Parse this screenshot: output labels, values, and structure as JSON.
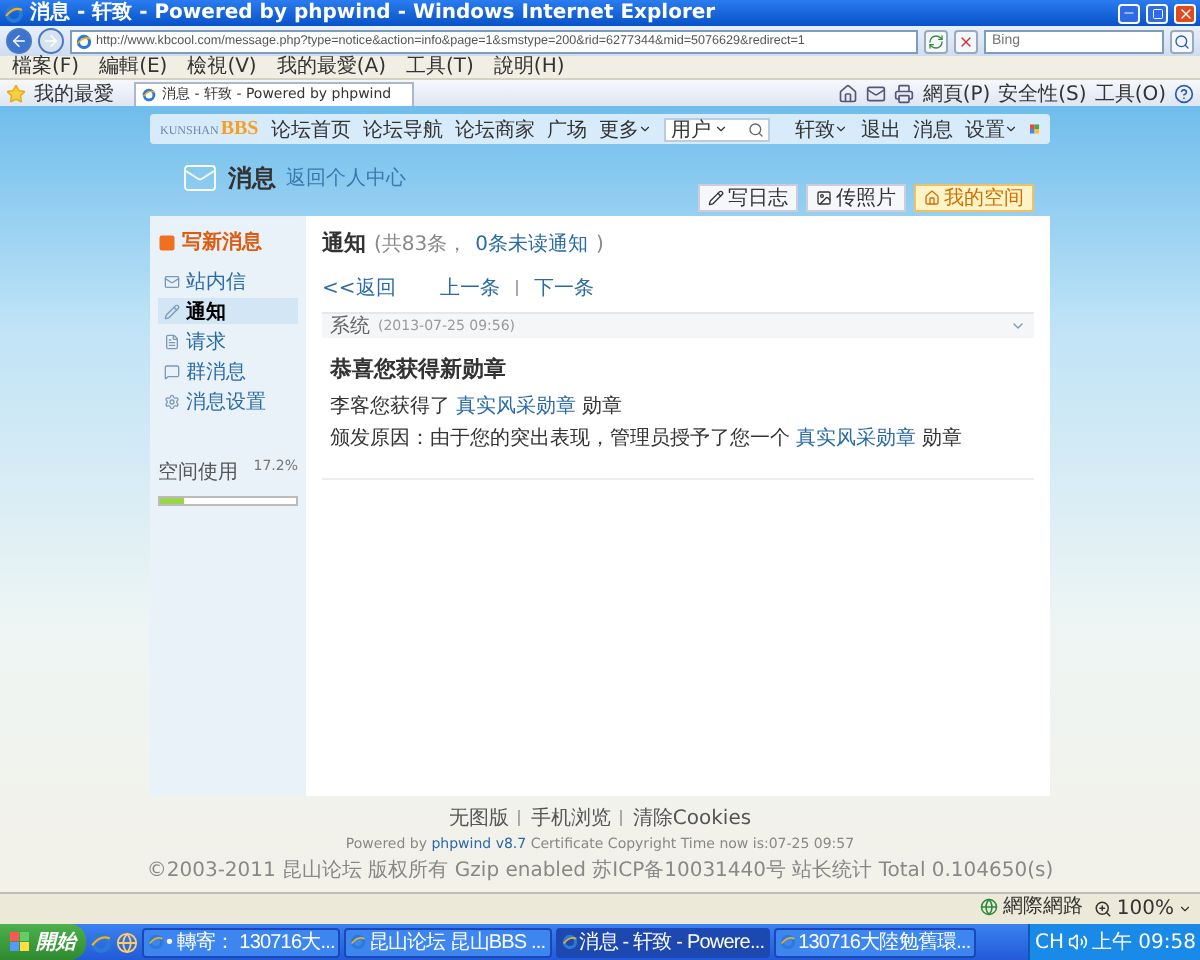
{
  "window": {
    "title": "消息 - 轩致 - Powered by phpwind - Windows Internet Explorer"
  },
  "address_bar": {
    "url": "http://www.kbcool.com/message.php?type=notice&action=info&page=1&smstype=200&rid=6277344&mid=5076629&redirect=1"
  },
  "search_box": {
    "placeholder": "Bing"
  },
  "menu_bar": [
    "檔案(F)",
    "編輯(E)",
    "檢視(V)",
    "我的最愛(A)",
    "工具(T)",
    "說明(H)"
  ],
  "favorites_bar": {
    "label": "我的最愛",
    "tabs": [
      {
        "label": "消息 - 轩致 - Powered by phpwind",
        "selected": true
      }
    ]
  },
  "command_bar": [
    "網頁(P)",
    "安全性(S)",
    "工具(O)"
  ],
  "site_nav": {
    "logo_small": "KUNSHAN",
    "logo_big": "BBS",
    "links": [
      {
        "label": "论坛首页",
        "dropdown": false
      },
      {
        "label": "论坛导航",
        "dropdown": false
      },
      {
        "label": "论坛商家",
        "dropdown": false
      },
      {
        "label": "广场",
        "dropdown": false
      },
      {
        "label": "更多",
        "dropdown": true
      }
    ],
    "search_scope": "用户",
    "user_links": [
      {
        "label": "轩致",
        "dropdown": true
      },
      {
        "label": "退出",
        "dropdown": false
      },
      {
        "label": "消息",
        "dropdown": false
      },
      {
        "label": "设置",
        "dropdown": true
      }
    ]
  },
  "banner": {
    "title": "消息",
    "subtitle": "返回个人中心",
    "buttons": [
      {
        "label": "写日志",
        "selected": false
      },
      {
        "label": "传照片",
        "selected": false
      },
      {
        "label": "我的空间",
        "selected": true
      }
    ]
  },
  "sidebar": {
    "compose": "写新消息",
    "items": [
      {
        "label": "站内信",
        "selected": false
      },
      {
        "label": "通知",
        "selected": true
      },
      {
        "label": "请求",
        "selected": false
      },
      {
        "label": "群消息",
        "selected": false
      },
      {
        "label": "消息设置",
        "selected": false
      }
    ],
    "storage": {
      "label": "空间使用",
      "reading": "17.2%",
      "level": 0.172
    }
  },
  "main": {
    "title": "通知",
    "count": "(共83条，",
    "unread": "0条未读通知",
    "count_end": ")",
    "back": "<<返回",
    "prev": "上一条",
    "next": "下一条",
    "message": {
      "sender": "系统",
      "time": "(2013-07-25 09:56)",
      "subject": "恭喜您获得新勋章",
      "lines": [
        {
          "before": "李客您获得了",
          "link": "真实风采勋章",
          "after": "勋章"
        },
        {
          "before": "颁发原因：由于您的突出表现，管理员授予了您一个",
          "link": "真实风采勋章",
          "after": "勋章"
        }
      ]
    }
  },
  "footer": {
    "links": [
      "无图版",
      "手机浏览",
      "清除Cookies"
    ],
    "powered_before": "Powered by",
    "powered_link": "phpwind v8.7",
    "powered_after": "Certificate Copyright Time now is:07-25 09:57",
    "copyright": "©2003-2011 昆山论坛 版权所有 Gzip enabled 苏ICP备10031440号 站长统计 Total 0.104650(s)"
  },
  "status_bar": {
    "zone": "網際網路",
    "zoom": "100%"
  },
  "taskbar": {
    "start": "開始",
    "tasks": [
      {
        "label": "• 轉寄： 130716大...",
        "selected": false
      },
      {
        "label": "昆山论坛 昆山BBS ...",
        "selected": false
      },
      {
        "label": "消息 - 轩致 - Powere...",
        "selected": true
      },
      {
        "label": "130716大陸勉舊環...",
        "selected": false
      }
    ],
    "language": "CH",
    "clock": "上午 09:58"
  }
}
